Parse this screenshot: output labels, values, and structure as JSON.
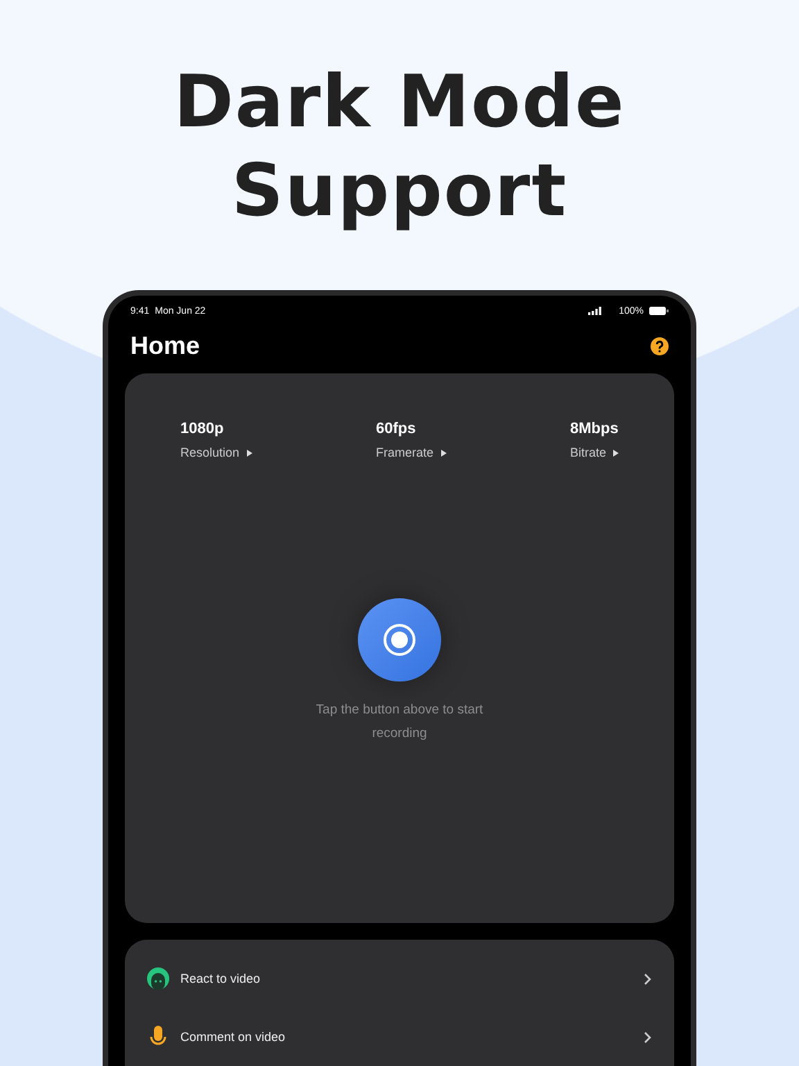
{
  "headline": [
    "Dark Mode",
    "Support"
  ],
  "status_bar": {
    "time": "9:41",
    "date": "Mon Jun 22",
    "battery": "100%"
  },
  "title": "Home",
  "stats": [
    {
      "value": "1080p",
      "label": "Resolution"
    },
    {
      "value": "60fps",
      "label": "Framerate"
    },
    {
      "value": "8Mbps",
      "label": "Bitrate"
    }
  ],
  "record_hint": "Tap the button above to start recording",
  "actions": [
    {
      "kind": "react",
      "label": "React to video"
    },
    {
      "kind": "comment",
      "label": "Comment on video"
    }
  ]
}
